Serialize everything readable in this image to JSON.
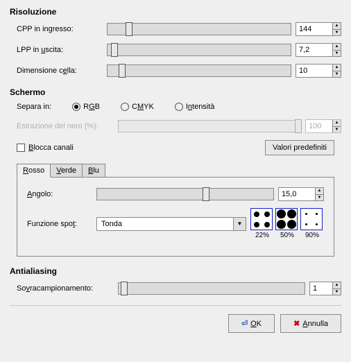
{
  "risoluzione": {
    "title": "Risoluzione",
    "cpp": {
      "label": "CPP in ingresso:",
      "value": "144",
      "thumb_pct": 10
    },
    "lpp": {
      "label": "LPP in uscita:",
      "value": "7,2",
      "thumb_pct": 2
    },
    "cella": {
      "label": "Dimensione cella:",
      "value": "10",
      "thumb_pct": 6
    }
  },
  "schermo": {
    "title": "Schermo",
    "separa_label": "Separa in:",
    "radios": {
      "rgb": "RGB",
      "cmyk": "CMYK",
      "intensita": "Intensità",
      "selected": "rgb"
    },
    "estrazione": {
      "label": "Estrazione del nero (%):",
      "value": "100",
      "thumb_pct": 98
    },
    "blocca": "Blocca canali",
    "valori_btn": "Valori predefiniti",
    "tabs": {
      "rosso": "Rosso",
      "verde": "Verde",
      "blu": "Blu"
    },
    "angolo": {
      "label": "Angolo:",
      "value": "15,0",
      "thumb_pct": 60
    },
    "spot": {
      "label": "Funzione spot:",
      "value": "Tonda"
    },
    "previews": {
      "a": "22%",
      "b": "50%",
      "c": "90%"
    }
  },
  "antialiasing": {
    "title": "Antialiasing",
    "sovra": {
      "label": "Sovracampionamento:",
      "value": "1",
      "thumb_pct": 1
    }
  },
  "buttons": {
    "ok": "OK",
    "annulla": "Annulla"
  }
}
